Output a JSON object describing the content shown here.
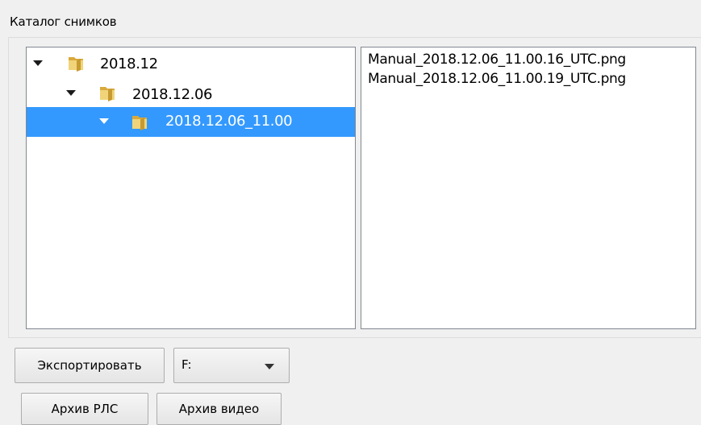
{
  "catalog": {
    "title": "Каталог снимков",
    "tree": [
      {
        "label": "2018.12",
        "icon": "folder-icon",
        "expanded": true
      },
      {
        "label": "2018.12.06",
        "icon": "folder-icon",
        "expanded": true
      },
      {
        "label": "2018.12.06_11.00",
        "icon": "folder-icon",
        "expanded": true,
        "selected": true
      }
    ],
    "files": [
      "Manual_2018.12.06_11.00.16_UTC.png",
      "Manual_2018.12.06_11.00.19_UTC.png"
    ]
  },
  "controls": {
    "export_label": "Экспортировать",
    "drive_value": "F:",
    "radar_archive_label": "Архив РЛС",
    "video_archive_label": "Архив видео"
  },
  "colors": {
    "selection": "#3399ff",
    "window_bg": "#f0f0f0",
    "panel_border": "#828790",
    "folder": "#e7c45c"
  }
}
